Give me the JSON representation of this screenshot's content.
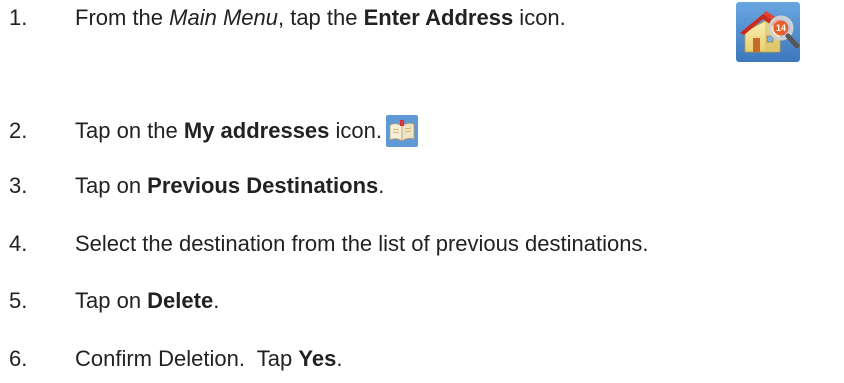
{
  "steps": [
    {
      "number": "1.",
      "prefix": "From the ",
      "italic": "Main Menu",
      "middle": ", tap the ",
      "bold": "Enter Address",
      "suffix": " icon.",
      "icon": "enter-address-house-magnifier-icon"
    },
    {
      "number": "2.",
      "prefix": "Tap on the ",
      "bold": "My addresses",
      "suffix": " icon.",
      "icon": "my-addresses-book-icon"
    },
    {
      "number": "3.",
      "prefix": "Tap on ",
      "bold": "Previous Destinations",
      "suffix": "."
    },
    {
      "number": "4.",
      "text": "Select the destination from the list of previous destinations."
    },
    {
      "number": "5.",
      "prefix": "Tap on ",
      "bold": "Delete",
      "suffix": "."
    },
    {
      "number": "6.",
      "prefix": "Confirm Deletion.  Tap ",
      "bold": "Yes",
      "suffix": "."
    }
  ],
  "icon_badge": "14",
  "colors": {
    "text": "#222222",
    "icon_background": "#4f8fd0",
    "roof": "#cc2a1e",
    "house_wall": "#f3e39a"
  }
}
